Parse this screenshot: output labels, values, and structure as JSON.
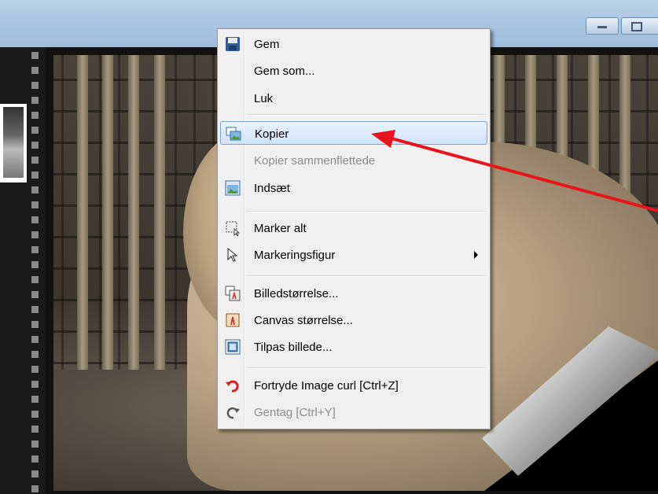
{
  "menu": {
    "items": [
      {
        "label": "Gem",
        "icon": "save-icon",
        "enabled": true
      },
      {
        "label": "Gem som...",
        "icon": "",
        "enabled": true
      },
      {
        "label": "Luk",
        "icon": "",
        "enabled": true
      },
      {
        "label": "Kopier",
        "icon": "copy-image-icon",
        "enabled": true,
        "highlighted": true
      },
      {
        "label": "Kopier sammenflettede",
        "icon": "",
        "enabled": false
      },
      {
        "label": "Indsæt",
        "icon": "paste-image-icon",
        "enabled": true
      },
      {
        "label": "Marker alt",
        "icon": "select-all-icon",
        "enabled": true
      },
      {
        "label": "Markeringsfigur",
        "icon": "pointer-icon",
        "enabled": true,
        "submenu": true
      },
      {
        "label": "Billedstørrelse...",
        "icon": "image-size-icon",
        "enabled": true
      },
      {
        "label": "Canvas størrelse...",
        "icon": "canvas-size-icon",
        "enabled": true
      },
      {
        "label": "Tilpas billede...",
        "icon": "fit-image-icon",
        "enabled": true
      },
      {
        "label": "Fortryde Image curl [Ctrl+Z]",
        "icon": "undo-icon",
        "enabled": true
      },
      {
        "label": "Gentag [Ctrl+Y]",
        "icon": "redo-icon",
        "enabled": false
      }
    ]
  },
  "window": {
    "buttons": [
      "minimize-icon",
      "maximize-icon"
    ]
  },
  "colors": {
    "highlight_border": "#7da2ce",
    "annotation_arrow": "#e8141b",
    "undo_icon": "#d42020"
  }
}
